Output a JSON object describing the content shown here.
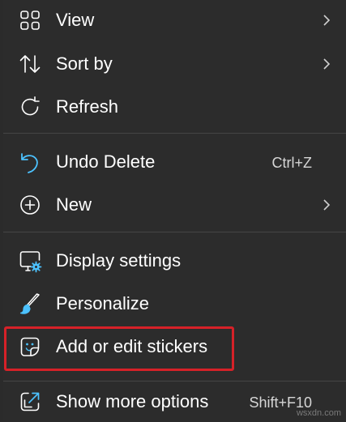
{
  "menu": {
    "items": [
      {
        "label": "View",
        "icon": "grid-view-icon",
        "has_submenu": true
      },
      {
        "label": "Sort by",
        "icon": "sort-arrows-icon",
        "has_submenu": true
      },
      {
        "label": "Refresh",
        "icon": "refresh-icon",
        "has_submenu": false
      },
      {
        "label": "Undo Delete",
        "icon": "undo-icon",
        "shortcut": "Ctrl+Z"
      },
      {
        "label": "New",
        "icon": "plus-circle-icon",
        "has_submenu": true
      },
      {
        "label": "Display settings",
        "icon": "display-settings-icon"
      },
      {
        "label": "Personalize",
        "icon": "paintbrush-icon"
      },
      {
        "label": "Add or edit stickers",
        "icon": "sticker-icon",
        "highlighted": true
      },
      {
        "label": "Show more options",
        "icon": "open-external-icon",
        "shortcut": "Shift+F10"
      }
    ]
  },
  "colors": {
    "background": "#2c2c2c",
    "accent": "#4cc2ff",
    "highlight_border": "#d62128",
    "text": "#ffffff"
  },
  "watermark": "wsxdn.com"
}
